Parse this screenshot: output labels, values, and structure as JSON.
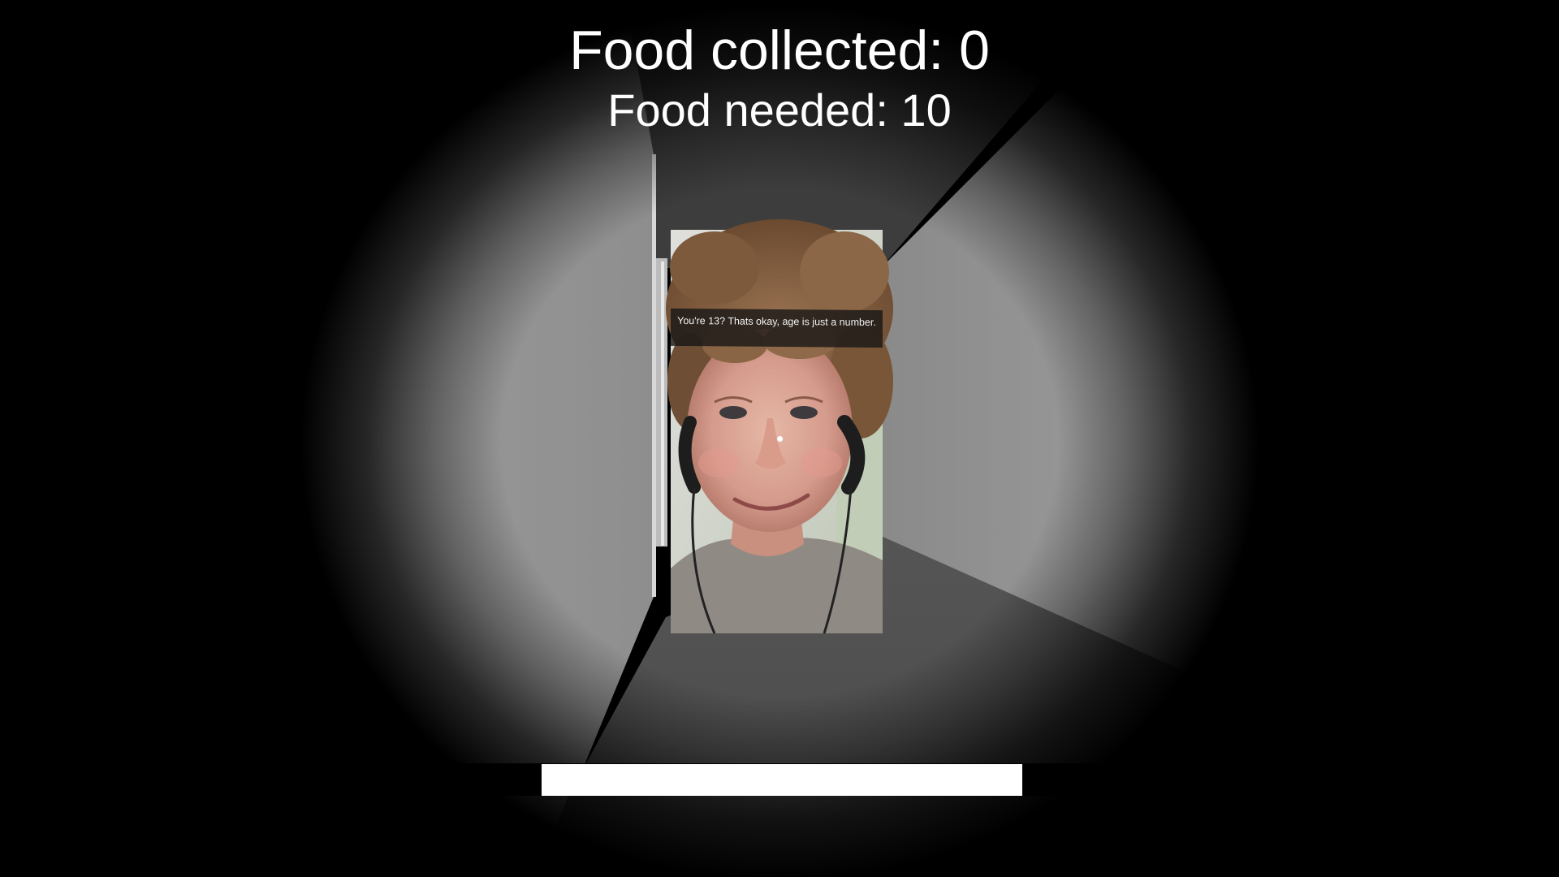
{
  "hud": {
    "food_collected_label": "Food collected: 0",
    "food_needed_label": "Food needed: 10"
  },
  "poster": {
    "caption": "You're 13? Thats okay, age is just a number."
  },
  "progress": {
    "fraction": 1.0
  },
  "colors": {
    "text": "#ffffff",
    "wall_light": "#9a9a9a",
    "wall_mid": "#6e6e6e",
    "floor": "#4a4a4a",
    "ceiling": "#3a3a3a",
    "background": "#000000"
  }
}
